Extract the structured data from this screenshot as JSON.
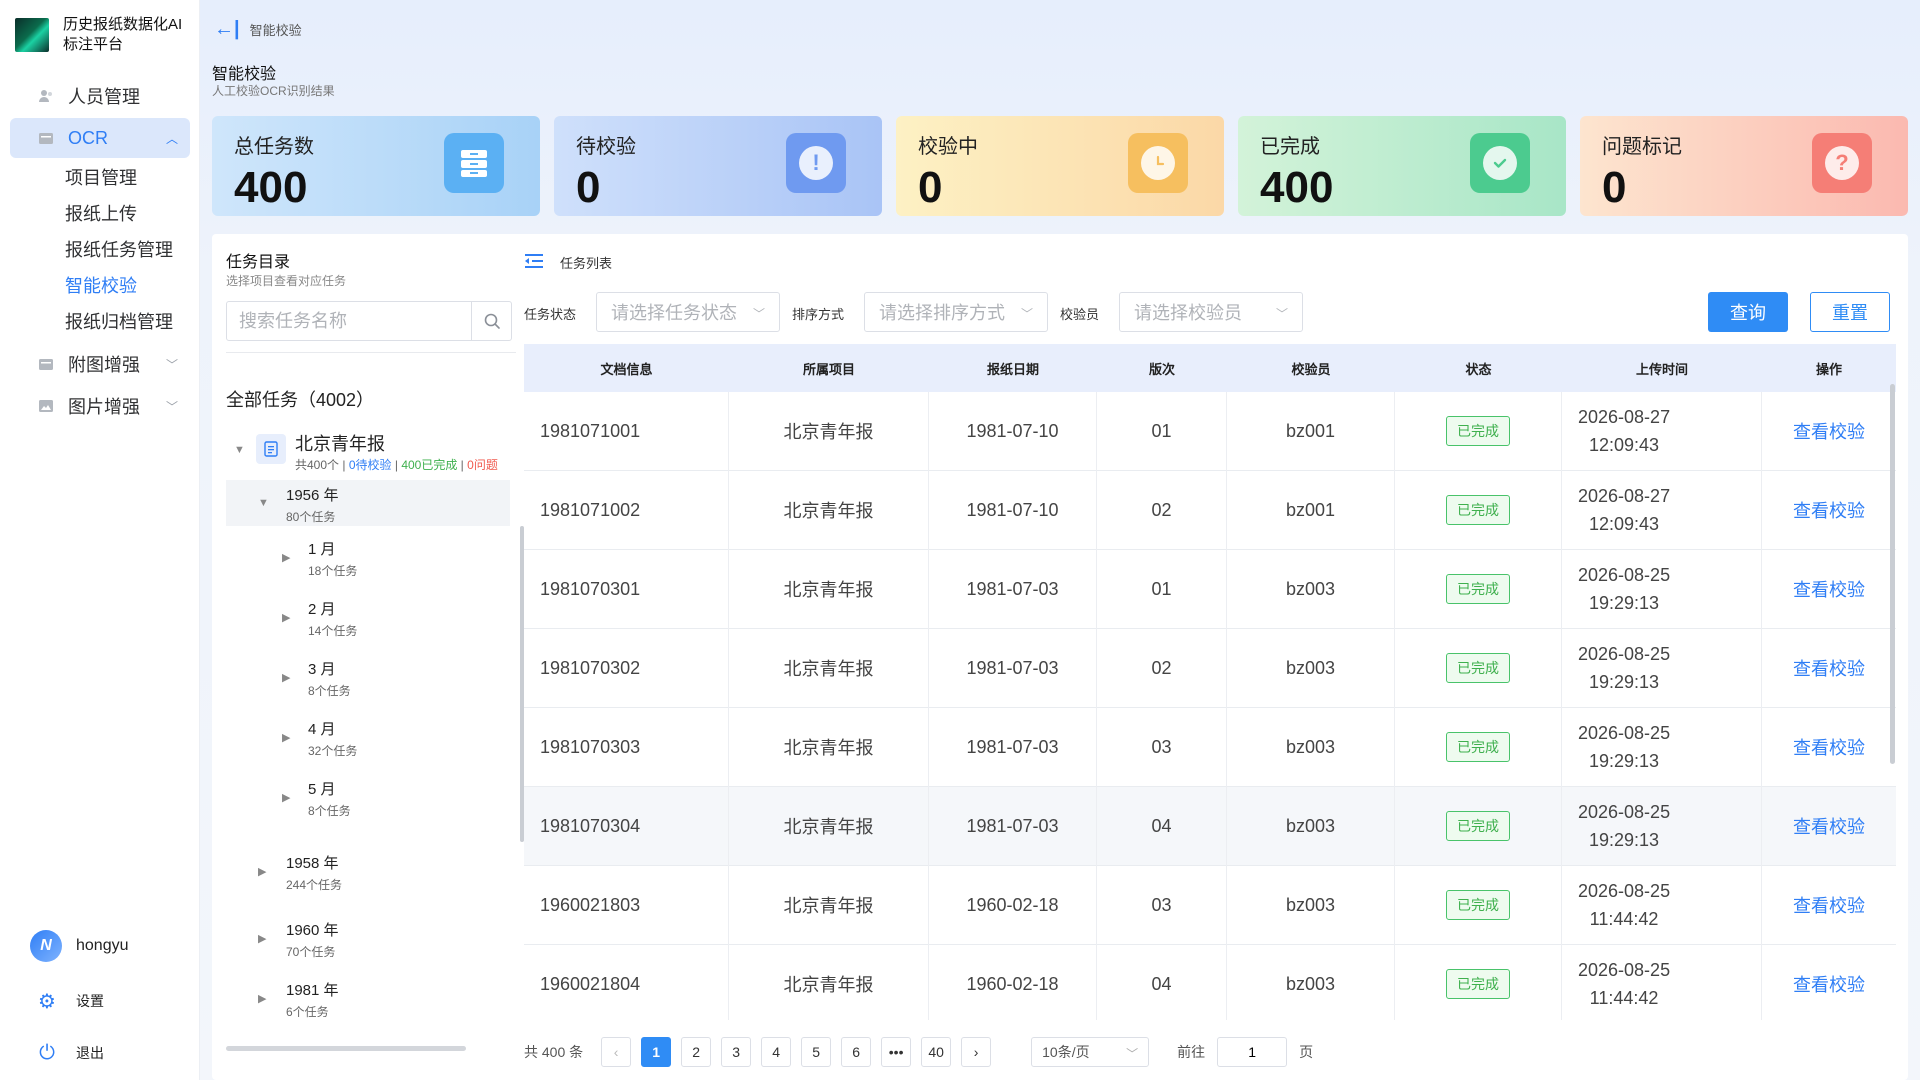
{
  "app": {
    "title": "历史报纸数据化AI标注平台"
  },
  "sidebar": {
    "items": [
      {
        "label": "人员管理"
      },
      {
        "label": "OCR"
      },
      {
        "label": "附图增强"
      },
      {
        "label": "图片增强"
      }
    ],
    "ocr_sub": [
      "项目管理",
      "报纸上传",
      "报纸任务管理",
      "智能校验",
      "报纸归档管理"
    ],
    "user": "hongyu",
    "avatar_text": "N",
    "settings": "设置",
    "logout": "退出"
  },
  "header": {
    "crumb": "智能校验",
    "title": "智能校验",
    "subtitle": "人工校验OCR识别结果"
  },
  "stats": [
    {
      "label": "总任务数",
      "value": "400",
      "icon": "archive-icon"
    },
    {
      "label": "待校验",
      "value": "0",
      "icon": "alert-icon"
    },
    {
      "label": "校验中",
      "value": "0",
      "icon": "clock-icon"
    },
    {
      "label": "已完成",
      "value": "400",
      "icon": "check-icon"
    },
    {
      "label": "问题标记",
      "value": "0",
      "icon": "question-icon"
    }
  ],
  "tree": {
    "title": "任务目录",
    "subtitle": "选择项目查看对应任务",
    "search_placeholder": "搜索任务名称",
    "all": "全部任务（4002）",
    "project": {
      "name": "北京青年报",
      "total": "共400个",
      "sep1": " | ",
      "pending": "0待校验",
      "sep2": " | ",
      "done": "400已完成",
      "sep3": " | ",
      "issues": "0问题"
    },
    "years": [
      {
        "name": "1956 年",
        "count": "80个任务"
      },
      {
        "name": "1958 年",
        "count": "244个任务"
      },
      {
        "name": "1960 年",
        "count": "70个任务"
      },
      {
        "name": "1981 年",
        "count": "6个任务"
      }
    ],
    "months": [
      {
        "name": "1 月",
        "count": "18个任务"
      },
      {
        "name": "2 月",
        "count": "14个任务"
      },
      {
        "name": "3 月",
        "count": "8个任务"
      },
      {
        "name": "4 月",
        "count": "32个任务"
      },
      {
        "name": "5 月",
        "count": "8个任务"
      }
    ]
  },
  "list": {
    "title": "任务列表",
    "filters": {
      "status_label": "任务状态",
      "status_placeholder": "请选择任务状态",
      "sort_label": "排序方式",
      "sort_placeholder": "请选择排序方式",
      "checker_label": "校验员",
      "checker_placeholder": "请选择校验员"
    },
    "query": "查询",
    "reset": "重置",
    "columns": [
      "文档信息",
      "所属项目",
      "报纸日期",
      "版次",
      "校验员",
      "状态",
      "上传时间",
      "操作"
    ],
    "rows": [
      {
        "doc": "1981071001",
        "project": "北京青年报",
        "date": "1981-07-10",
        "edition": "01",
        "checker": "bz001",
        "status": "已完成",
        "date_up": "2026-08-27",
        "time_up": "12:09:43",
        "op": "查看校验"
      },
      {
        "doc": "1981071002",
        "project": "北京青年报",
        "date": "1981-07-10",
        "edition": "02",
        "checker": "bz001",
        "status": "已完成",
        "date_up": "2026-08-27",
        "time_up": "12:09:43",
        "op": "查看校验"
      },
      {
        "doc": "1981070301",
        "project": "北京青年报",
        "date": "1981-07-03",
        "edition": "01",
        "checker": "bz003",
        "status": "已完成",
        "date_up": "2026-08-25",
        "time_up": "19:29:13",
        "op": "查看校验"
      },
      {
        "doc": "1981070302",
        "project": "北京青年报",
        "date": "1981-07-03",
        "edition": "02",
        "checker": "bz003",
        "status": "已完成",
        "date_up": "2026-08-25",
        "time_up": "19:29:13",
        "op": "查看校验"
      },
      {
        "doc": "1981070303",
        "project": "北京青年报",
        "date": "1981-07-03",
        "edition": "03",
        "checker": "bz003",
        "status": "已完成",
        "date_up": "2026-08-25",
        "time_up": "19:29:13",
        "op": "查看校验"
      },
      {
        "doc": "1981070304",
        "project": "北京青年报",
        "date": "1981-07-03",
        "edition": "04",
        "checker": "bz003",
        "status": "已完成",
        "date_up": "2026-08-25",
        "time_up": "19:29:13",
        "op": "查看校验"
      },
      {
        "doc": "1960021803",
        "project": "北京青年报",
        "date": "1960-02-18",
        "edition": "03",
        "checker": "bz003",
        "status": "已完成",
        "date_up": "2026-08-25",
        "time_up": "11:44:42",
        "op": "查看校验"
      },
      {
        "doc": "1960021804",
        "project": "北京青年报",
        "date": "1960-02-18",
        "edition": "04",
        "checker": "bz003",
        "status": "已完成",
        "date_up": "2026-08-25",
        "time_up": "11:44:42",
        "op": "查看校验"
      }
    ],
    "pagination": {
      "total": "共 400 条",
      "pages": [
        "1",
        "2",
        "3",
        "4",
        "5",
        "6",
        "•••",
        "40"
      ],
      "current": "1",
      "page_size": "10条/页",
      "goto_label": "前往",
      "goto_value": "1",
      "goto_suffix": "页"
    }
  },
  "colors": {
    "accent": "#2f7ef5",
    "success": "#3fb04e",
    "danger": "#f05a4f"
  }
}
